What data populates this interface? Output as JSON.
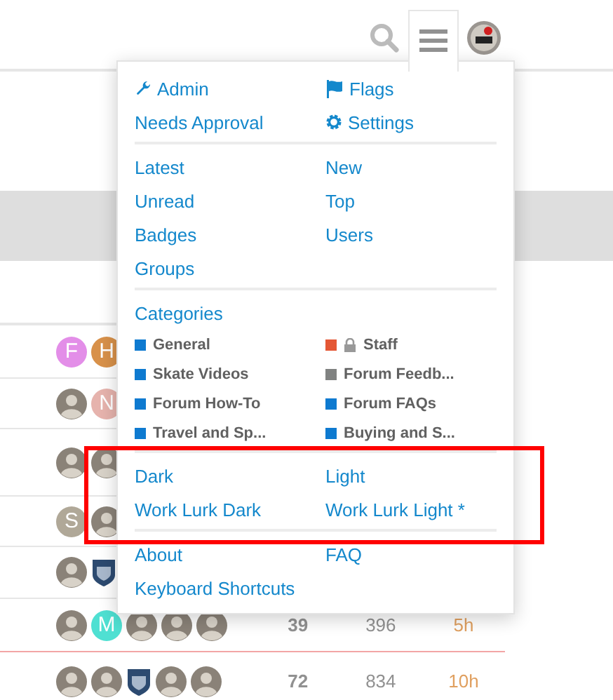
{
  "menu": {
    "sections": [
      {
        "kind": "links",
        "items": [
          {
            "label": "Admin"
          },
          {
            "label": "Flags"
          },
          {
            "label": "Needs Approval"
          },
          {
            "label": "Settings"
          }
        ]
      },
      {
        "kind": "links",
        "items": [
          {
            "label": "Latest"
          },
          {
            "label": "New"
          },
          {
            "label": "Unread"
          },
          {
            "label": "Top"
          },
          {
            "label": "Badges"
          },
          {
            "label": "Users"
          },
          {
            "label": "Groups"
          }
        ]
      },
      {
        "kind": "categories",
        "heading": "Categories",
        "items": [
          {
            "label": "General",
            "color": "#0e7ad0",
            "locked": false
          },
          {
            "label": "Staff",
            "color": "#e45735",
            "locked": true
          },
          {
            "label": "Skate Videos",
            "color": "#0e7ad0",
            "locked": false
          },
          {
            "label": "Forum Feedb...",
            "color": "#808281",
            "locked": false
          },
          {
            "label": "Forum How-To",
            "color": "#0e7ad0",
            "locked": false
          },
          {
            "label": "Forum FAQs",
            "color": "#0e7ad0",
            "locked": false
          },
          {
            "label": "Travel and Sp...",
            "color": "#0e7ad0",
            "locked": false
          },
          {
            "label": "Buying and S...",
            "color": "#0e7ad0",
            "locked": false
          }
        ]
      },
      {
        "kind": "links",
        "highlighted": true,
        "items": [
          {
            "label": "Dark"
          },
          {
            "label": "Light"
          },
          {
            "label": "Work Lurk Dark"
          },
          {
            "label": "Work Lurk Light *"
          }
        ]
      },
      {
        "kind": "links",
        "items": [
          {
            "label": "About"
          },
          {
            "label": "FAQ"
          },
          {
            "label": "Keyboard Shortcuts"
          }
        ]
      }
    ]
  },
  "topics": [
    {
      "last_visit_line": false,
      "avatars": [
        {
          "kind": "letter",
          "letter": "F",
          "color": "#e38ee8"
        },
        {
          "kind": "letter",
          "letter": "H",
          "color": "#d8914a"
        }
      ]
    },
    {
      "last_visit_line": false,
      "avatars": [
        {
          "kind": "image"
        },
        {
          "kind": "letter",
          "letter": "N",
          "color": "#e6b3ad"
        }
      ]
    },
    {
      "last_visit_line": false,
      "avatars": [
        {
          "kind": "image"
        },
        {
          "kind": "image"
        }
      ]
    },
    {
      "last_visit_line": false,
      "avatars": [
        {
          "kind": "letter",
          "letter": "S",
          "color": "#b0a898"
        },
        {
          "kind": "image"
        }
      ]
    },
    {
      "last_visit_line": false,
      "avatars": [
        {
          "kind": "image"
        },
        {
          "kind": "shield"
        }
      ]
    },
    {
      "last_visit_line": false,
      "avatars": [
        {
          "kind": "image"
        },
        {
          "kind": "letter",
          "letter": "M",
          "color": "#4fe0d2"
        },
        {
          "kind": "image"
        },
        {
          "kind": "image"
        },
        {
          "kind": "image"
        }
      ],
      "cells": [
        "39",
        "396",
        "5h"
      ]
    },
    {
      "last_visit_line": true,
      "avatars": [
        {
          "kind": "image"
        },
        {
          "kind": "image"
        },
        {
          "kind": "shield"
        },
        {
          "kind": "image"
        },
        {
          "kind": "image"
        }
      ],
      "cells": [
        "72",
        "834",
        "10h"
      ]
    }
  ]
}
